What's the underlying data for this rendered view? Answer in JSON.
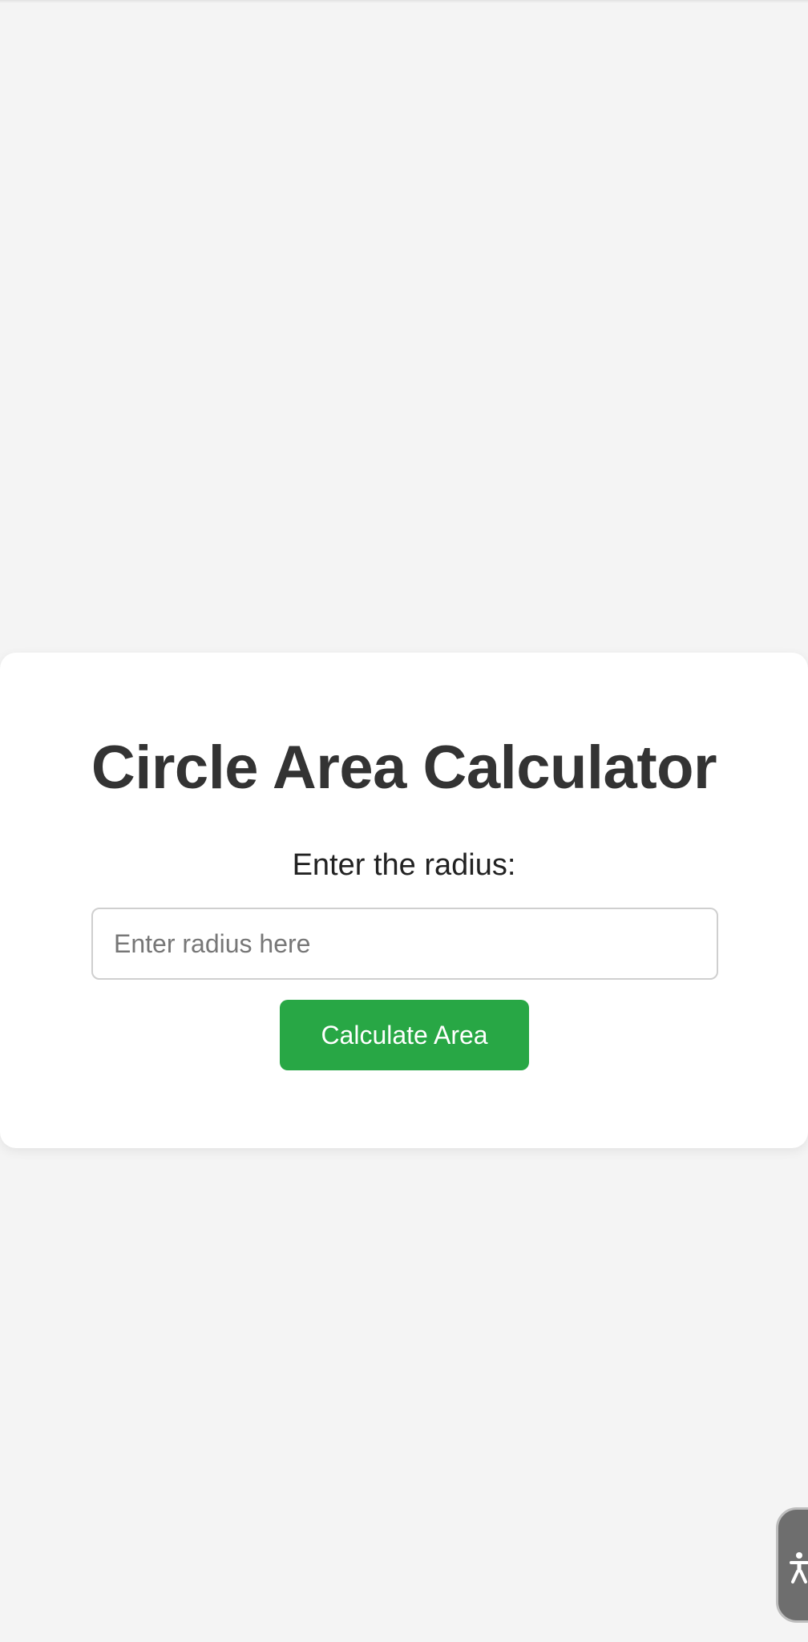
{
  "calculator": {
    "title": "Circle Area Calculator",
    "radius_label": "Enter the radius:",
    "radius_placeholder": "Enter radius here",
    "radius_value": "",
    "calculate_label": "Calculate Area"
  },
  "accessibility": {
    "icon": "accessibility-person-icon"
  },
  "colors": {
    "background": "#f4f4f4",
    "card": "#ffffff",
    "button": "#28a745",
    "title": "#333333"
  }
}
